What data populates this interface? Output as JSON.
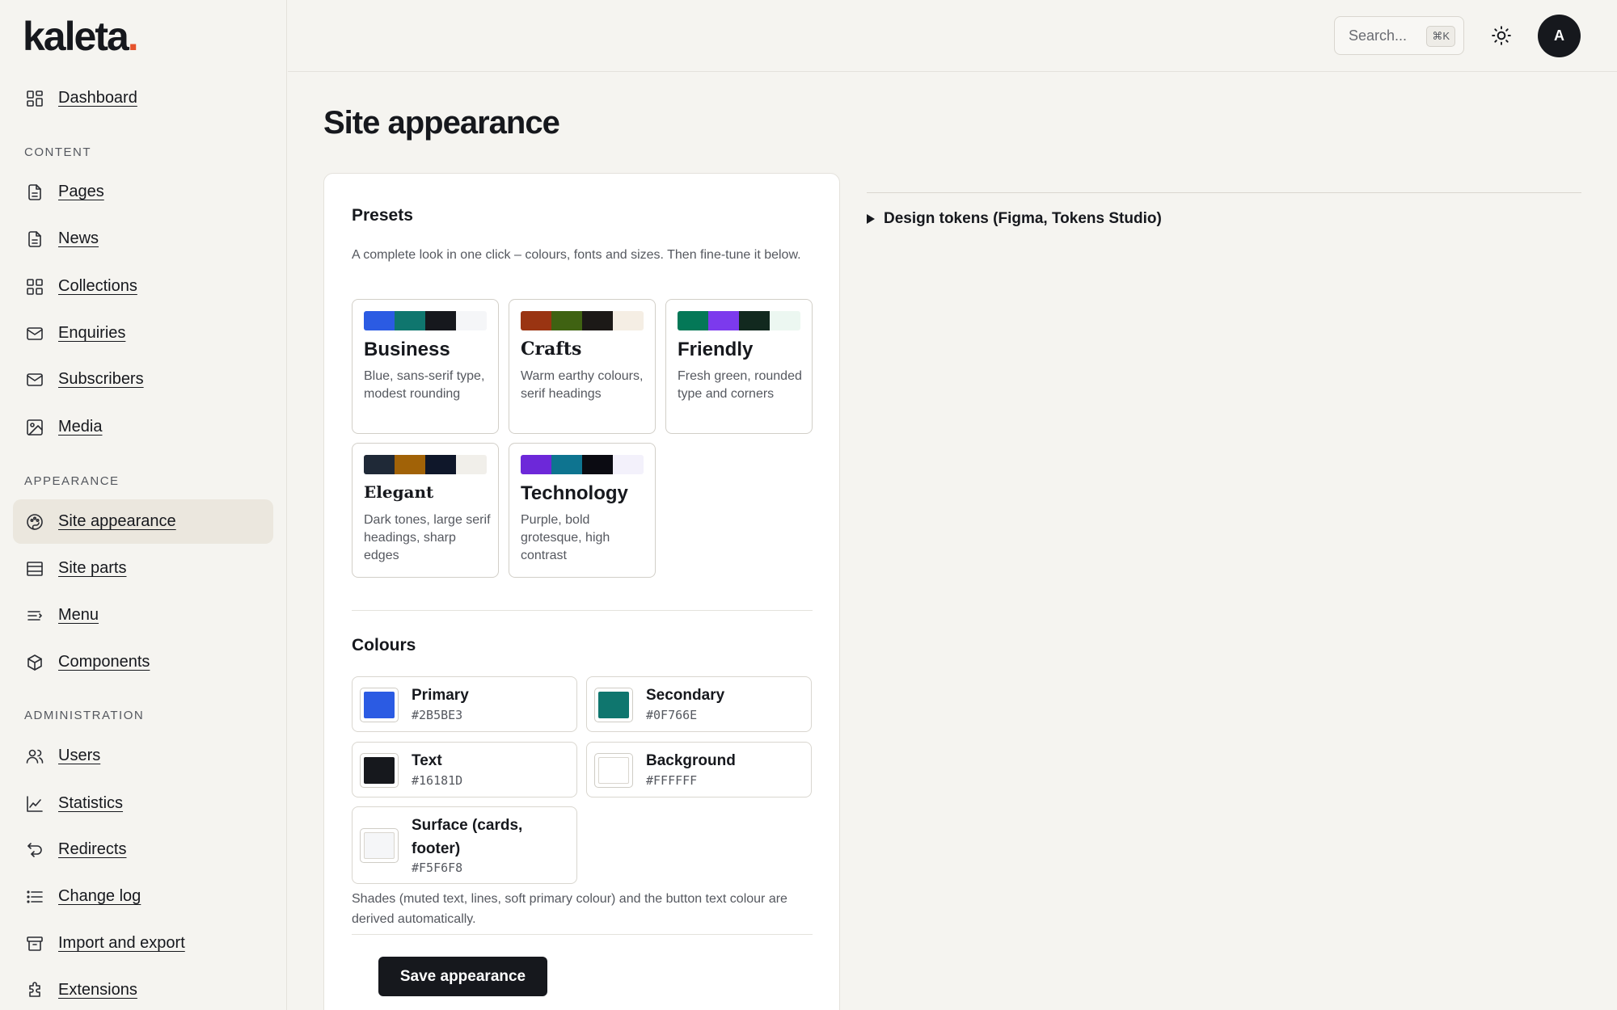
{
  "brand": {
    "name": "kaleta",
    "dot": ".",
    "dot_color": "#E5532C"
  },
  "sidebar": {
    "dashboard": "Dashboard",
    "sections": {
      "content": "CONTENT",
      "appearance": "APPEARANCE",
      "administration": "ADMINISTRATION"
    },
    "items": [
      {
        "label": "Dashboard",
        "icon": "grid-icon"
      },
      {
        "label": "Pages",
        "icon": "document-icon"
      },
      {
        "label": "News",
        "icon": "document-icon"
      },
      {
        "label": "Collections",
        "icon": "grid-icon"
      },
      {
        "label": "Enquiries",
        "icon": "mail-icon"
      },
      {
        "label": "Subscribers",
        "icon": "mail-icon"
      },
      {
        "label": "Media",
        "icon": "image-icon"
      },
      {
        "label": "Site appearance",
        "icon": "palette-icon",
        "active": true
      },
      {
        "label": "Site parts",
        "icon": "layout-icon"
      },
      {
        "label": "Menu",
        "icon": "menu-icon"
      },
      {
        "label": "Components",
        "icon": "cube-icon"
      },
      {
        "label": "Users",
        "icon": "users-icon"
      },
      {
        "label": "Statistics",
        "icon": "chart-icon"
      },
      {
        "label": "Redirects",
        "icon": "redirect-icon"
      },
      {
        "label": "Change log",
        "icon": "list-icon"
      },
      {
        "label": "Import and export",
        "icon": "archive-icon"
      },
      {
        "label": "Extensions",
        "icon": "puzzle-icon"
      }
    ]
  },
  "topbar": {
    "search_placeholder": "Search...",
    "search_shortcut": "⌘K",
    "theme_toggle_icon": "sun-icon",
    "avatar_initial": "A"
  },
  "main": {
    "title": "Site appearance",
    "presets": {
      "heading": "Presets",
      "description": "A complete look in one click – colours, fonts and sizes. Then fine-tune it below.",
      "items": [
        {
          "name": "Business",
          "desc": "Blue, sans-serif type, modest rounding",
          "swatches": [
            "#2B5BE3",
            "#0F766E",
            "#16181D",
            "#F5F6F8"
          ]
        },
        {
          "name": "Crafts",
          "desc": "Warm earthy colours, serif headings",
          "swatches": [
            "#9A3412",
            "#3F6212",
            "#1C1917",
            "#F5EEE4"
          ]
        },
        {
          "name": "Friendly",
          "desc": "Fresh green, rounded type and corners",
          "swatches": [
            "#047857",
            "#7C3AED",
            "#12291F",
            "#ECF7F1"
          ]
        },
        {
          "name": "Elegant",
          "desc": "Dark tones, large serif headings, sharp edges",
          "swatches": [
            "#1F2937",
            "#A16207",
            "#0F172A",
            "#F1EFEA"
          ]
        },
        {
          "name": "Technology",
          "desc": "Purple, bold grotesque, high contrast",
          "swatches": [
            "#6D28D9",
            "#0E7490",
            "#0B0B12",
            "#F3F1FB"
          ]
        }
      ]
    },
    "colours": {
      "heading": "Colours",
      "items": [
        {
          "name": "Primary",
          "hex": "#2B5BE3"
        },
        {
          "name": "Secondary",
          "hex": "#0F766E"
        },
        {
          "name": "Text",
          "hex": "#16181D"
        },
        {
          "name": "Background",
          "hex": "#FFFFFF"
        },
        {
          "name": "Surface (cards, footer)",
          "hex": "#F5F6F8"
        }
      ],
      "note": "Shades (muted text, lines, soft primary colour) and the button text colour are derived automatically."
    },
    "save_label": "Save appearance",
    "tokens_label": "Design tokens (Figma, Tokens Studio)"
  }
}
